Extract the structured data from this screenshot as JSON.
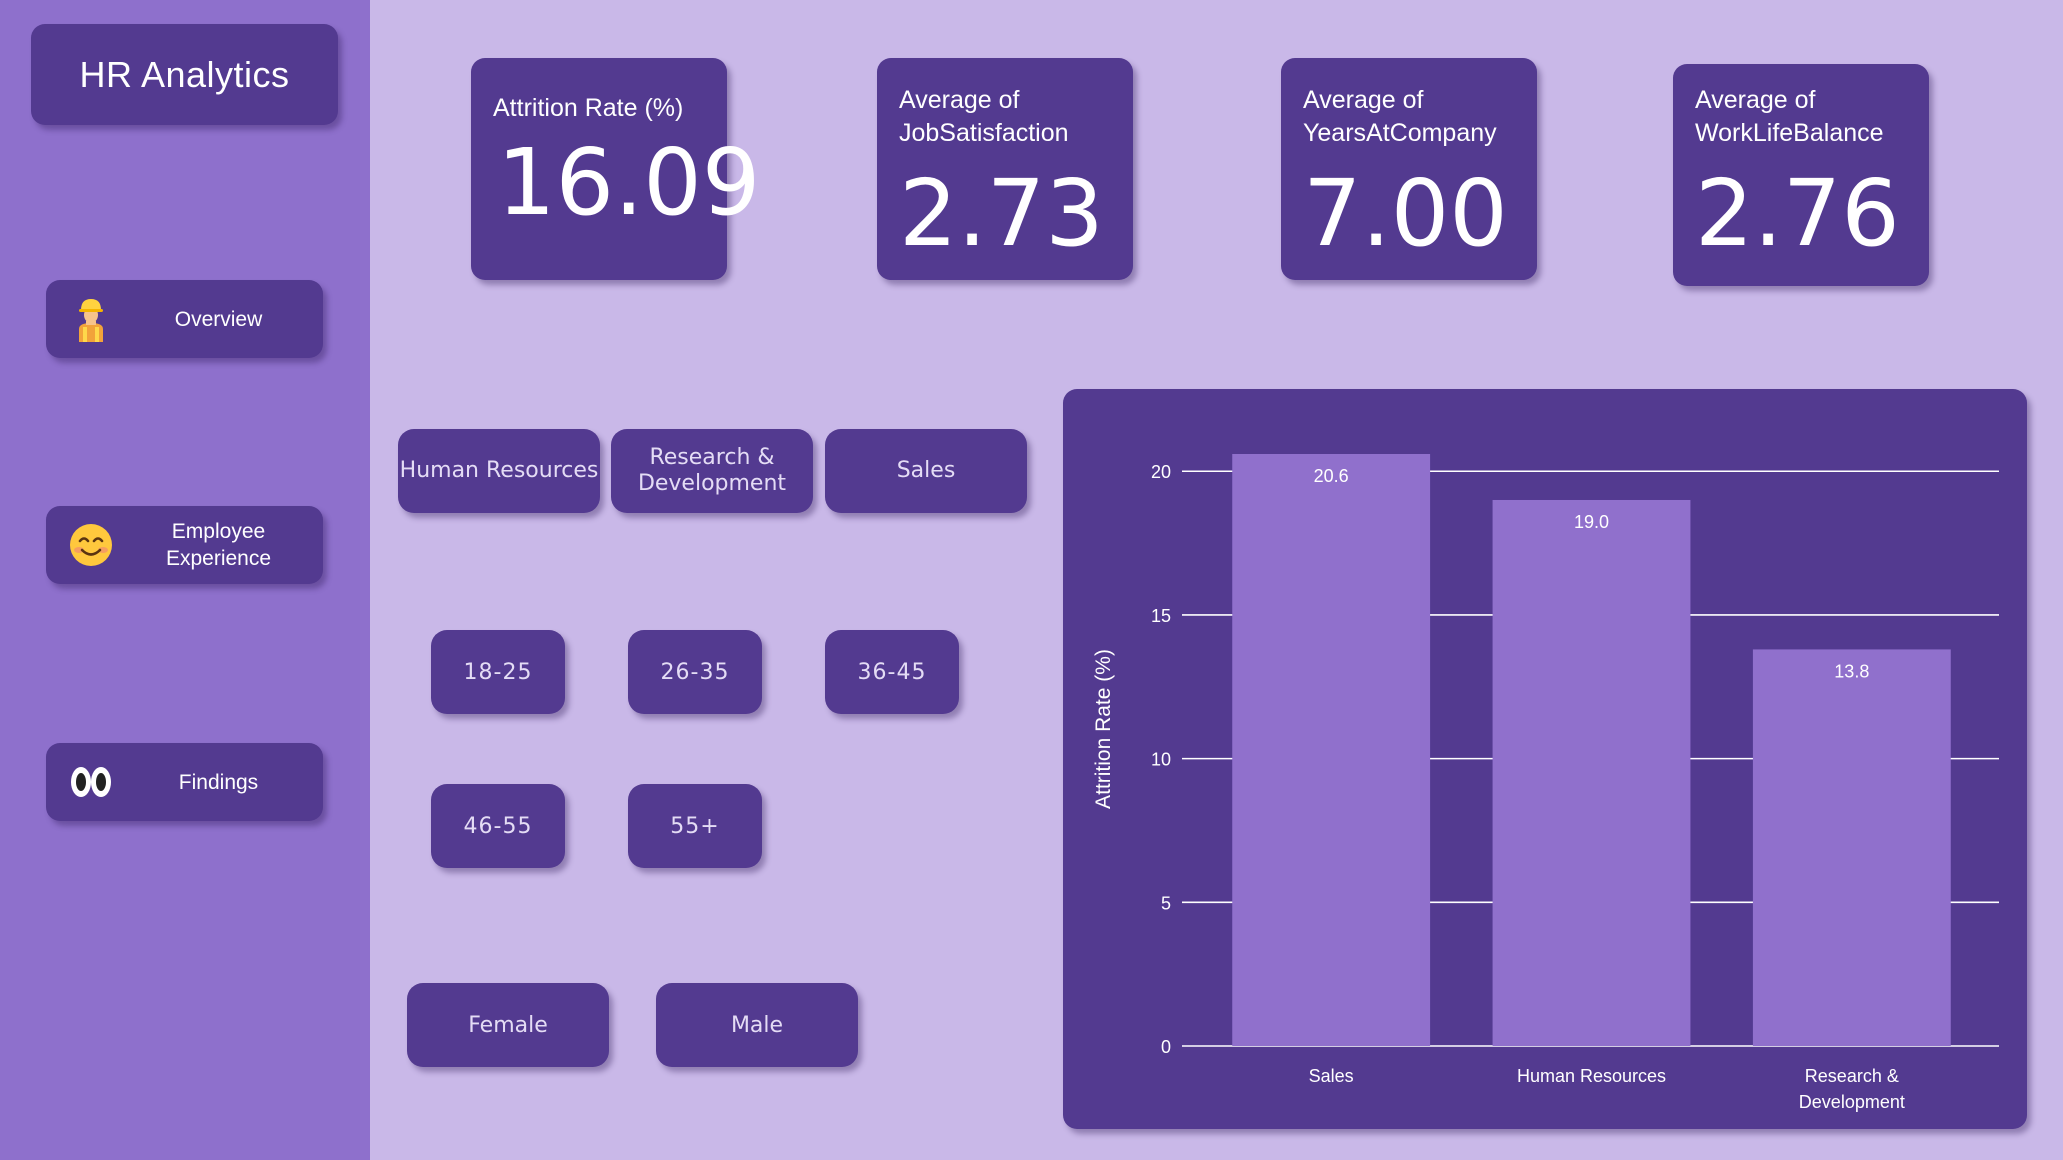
{
  "app": {
    "title": "HR Analytics"
  },
  "sidebar": {
    "items": [
      {
        "label": "Overview",
        "icon": "construction-worker-icon"
      },
      {
        "label": "Employee Experience",
        "icon": "smiling-face-icon"
      },
      {
        "label": "Findings",
        "icon": "eyes-icon"
      }
    ]
  },
  "kpis": [
    {
      "label": "Attrition Rate (%)",
      "value": "16.09"
    },
    {
      "label": "Average of JobSatisfaction",
      "value": "2.73"
    },
    {
      "label": "Average of YearsAtCompany",
      "value": "7.00"
    },
    {
      "label": "Average of WorkLifeBalance",
      "value": "2.76"
    }
  ],
  "filters": {
    "departments": [
      "Human Resources",
      "Research & Development",
      "Sales"
    ],
    "age_groups": [
      "18-25",
      "26-35",
      "36-45",
      "46-55",
      "55+"
    ],
    "genders": [
      "Female",
      "Male"
    ]
  },
  "colors": {
    "page_background": "#c9b8e8",
    "sidebar": "#8e70cc",
    "card": "#533a90",
    "bar": "#9070cc",
    "text": "#ffffff"
  },
  "chart_data": {
    "type": "bar",
    "categories": [
      "Sales",
      "Human Resources",
      "Research & Development"
    ],
    "values": [
      20.6,
      19.0,
      13.8
    ],
    "data_labels": [
      "20.6",
      "19.0",
      "13.8"
    ],
    "ylabel": "Attrition Rate (%)",
    "xlabel": "",
    "ylim": [
      0,
      20.6
    ],
    "yticks": [
      0,
      5,
      10,
      15,
      20
    ],
    "grid": true
  }
}
